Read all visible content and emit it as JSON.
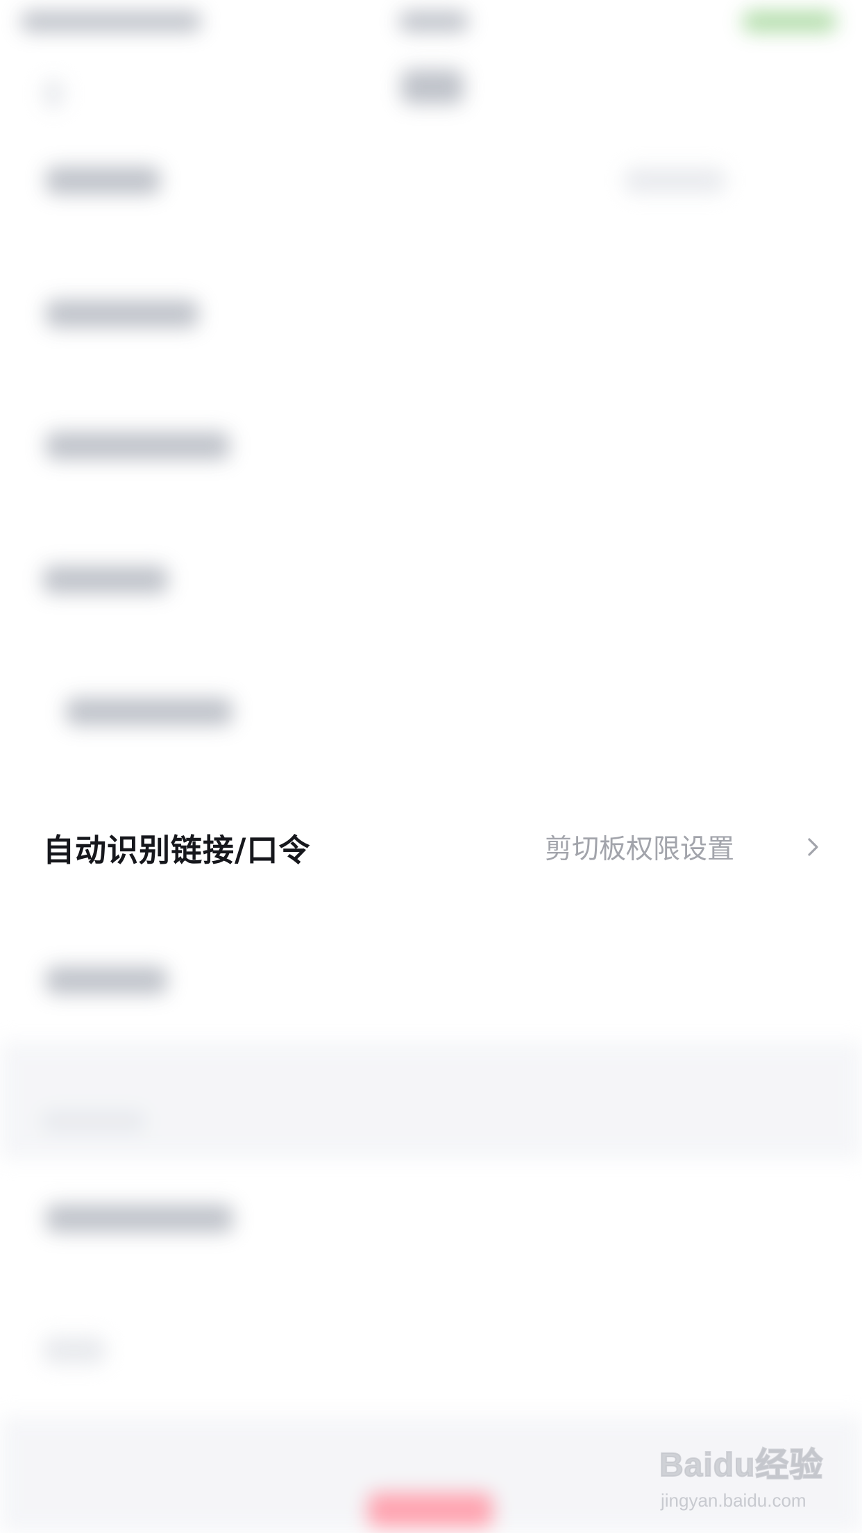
{
  "settings": {
    "focused_row": {
      "label": "自动识别链接/口令",
      "value": "剪切板权限设置"
    }
  },
  "watermark": {
    "logo_text": "Baidu经验",
    "url": "jingyan.baidu.com"
  },
  "colors": {
    "label": "#16171c",
    "value": "#a2a4ab",
    "chevron": "#a2a4ab",
    "background": "#ffffff",
    "section_band": "#f4f5f8"
  },
  "icons": {
    "row_chevron": "chevron-right-icon"
  }
}
